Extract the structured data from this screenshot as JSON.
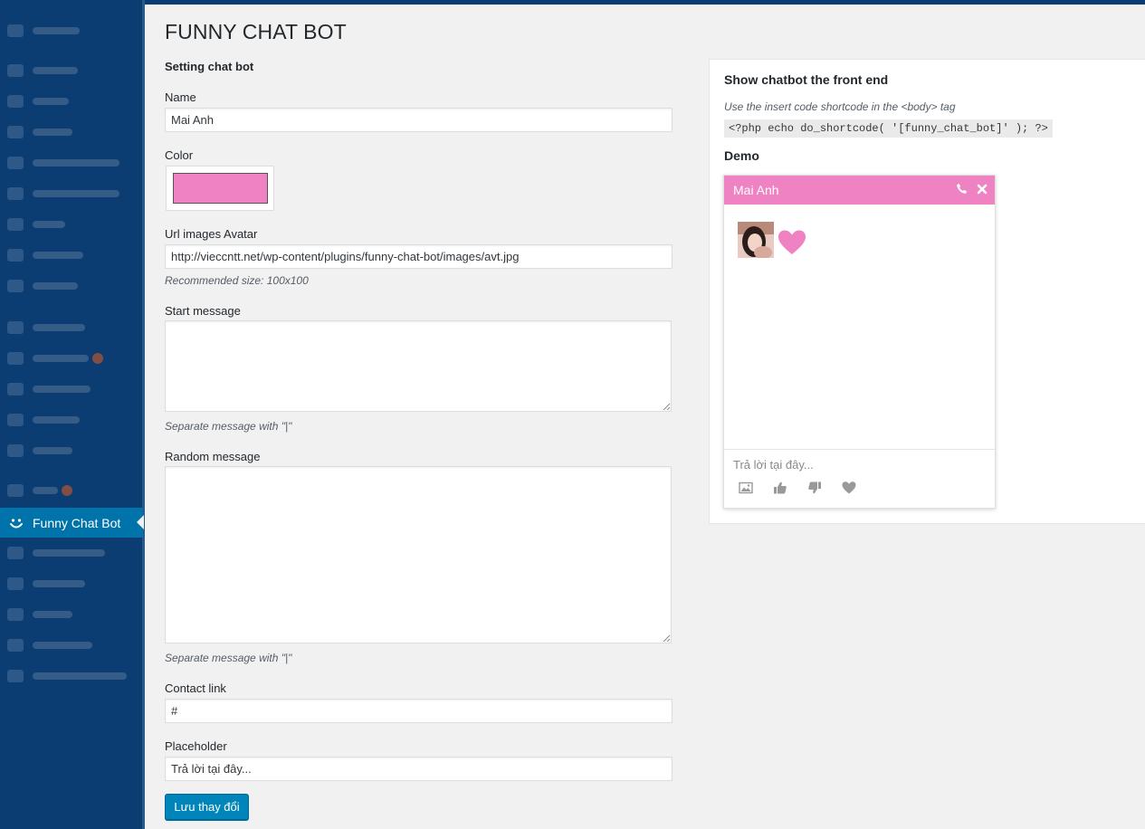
{
  "app": {
    "page_title": "FUNNY CHAT BOT"
  },
  "sidebar": {
    "active_label": "Funny Chat Bot",
    "icons": [
      "dashboard-icon",
      "pin-icon",
      "media-icon",
      "pages-icon",
      "comments-icon",
      "subscribe-icon",
      "builder-icon",
      "theme-icon",
      "widget-icon",
      "contact-icon",
      "pin-icon",
      "tag-icon",
      "users-icon",
      "tools-icon",
      "settings-icon",
      "seo-icon",
      "smile-icon",
      "optimize-icon",
      "plugin-icon",
      "gear-icon",
      "status-icon",
      "collapse-icon"
    ]
  },
  "form": {
    "section_title": "Setting chat bot",
    "name_label": "Name",
    "name_value": "Mai Anh",
    "color_label": "Color",
    "color_value": "#ef82c3",
    "avatar_label": "Url images Avatar",
    "avatar_value": "http://vieccntt.net/wp-content/plugins/funny-chat-bot/images/avt.jpg",
    "avatar_hint": "Recommended size: 100x100",
    "start_label": "Start message",
    "start_hint": "Separate message with \"|\"",
    "random_label": "Random message",
    "random_hint": "Separate message with \"|\"",
    "contact_label": "Contact link",
    "contact_value": "#",
    "placeholder_label": "Placeholder",
    "placeholder_value": "Trả lời tại đây...",
    "save_label": "Lưu thay đổi"
  },
  "panel": {
    "heading": "Show chatbot the front end",
    "note": "Use the insert code shortcode in the <body> tag",
    "code": "<?php echo do_shortcode( '[funny_chat_bot]' ); ?>",
    "demo_label": "Demo"
  },
  "chat": {
    "name": "Mai Anh",
    "accent": "#ef82c3",
    "input_placeholder": "Trả lời tại đây...",
    "header_icons": [
      "phone-icon",
      "close-icon"
    ],
    "toolbar_icons": [
      "image-icon",
      "thumbs-up-icon",
      "thumbs-down-icon",
      "heart-icon"
    ]
  }
}
